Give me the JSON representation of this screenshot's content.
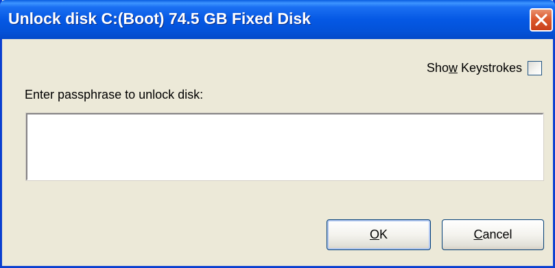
{
  "window": {
    "title": "Unlock disk C:(Boot) 74.5 GB Fixed Disk",
    "close_icon": "close-icon",
    "colors": {
      "titlebar": "#0558E4",
      "close_button": "#DC5A2E",
      "face": "#ECE9D8"
    }
  },
  "show_keystrokes": {
    "label_pre": "Sho",
    "label_mnemonic": "w",
    "label_post": " Keystrokes",
    "checked": false
  },
  "passphrase": {
    "prompt": "Enter passphrase to unlock disk:",
    "value": ""
  },
  "buttons": {
    "ok_mnemonic": "O",
    "ok_rest": "K",
    "cancel_mnemonic": "C",
    "cancel_rest": "ancel"
  }
}
